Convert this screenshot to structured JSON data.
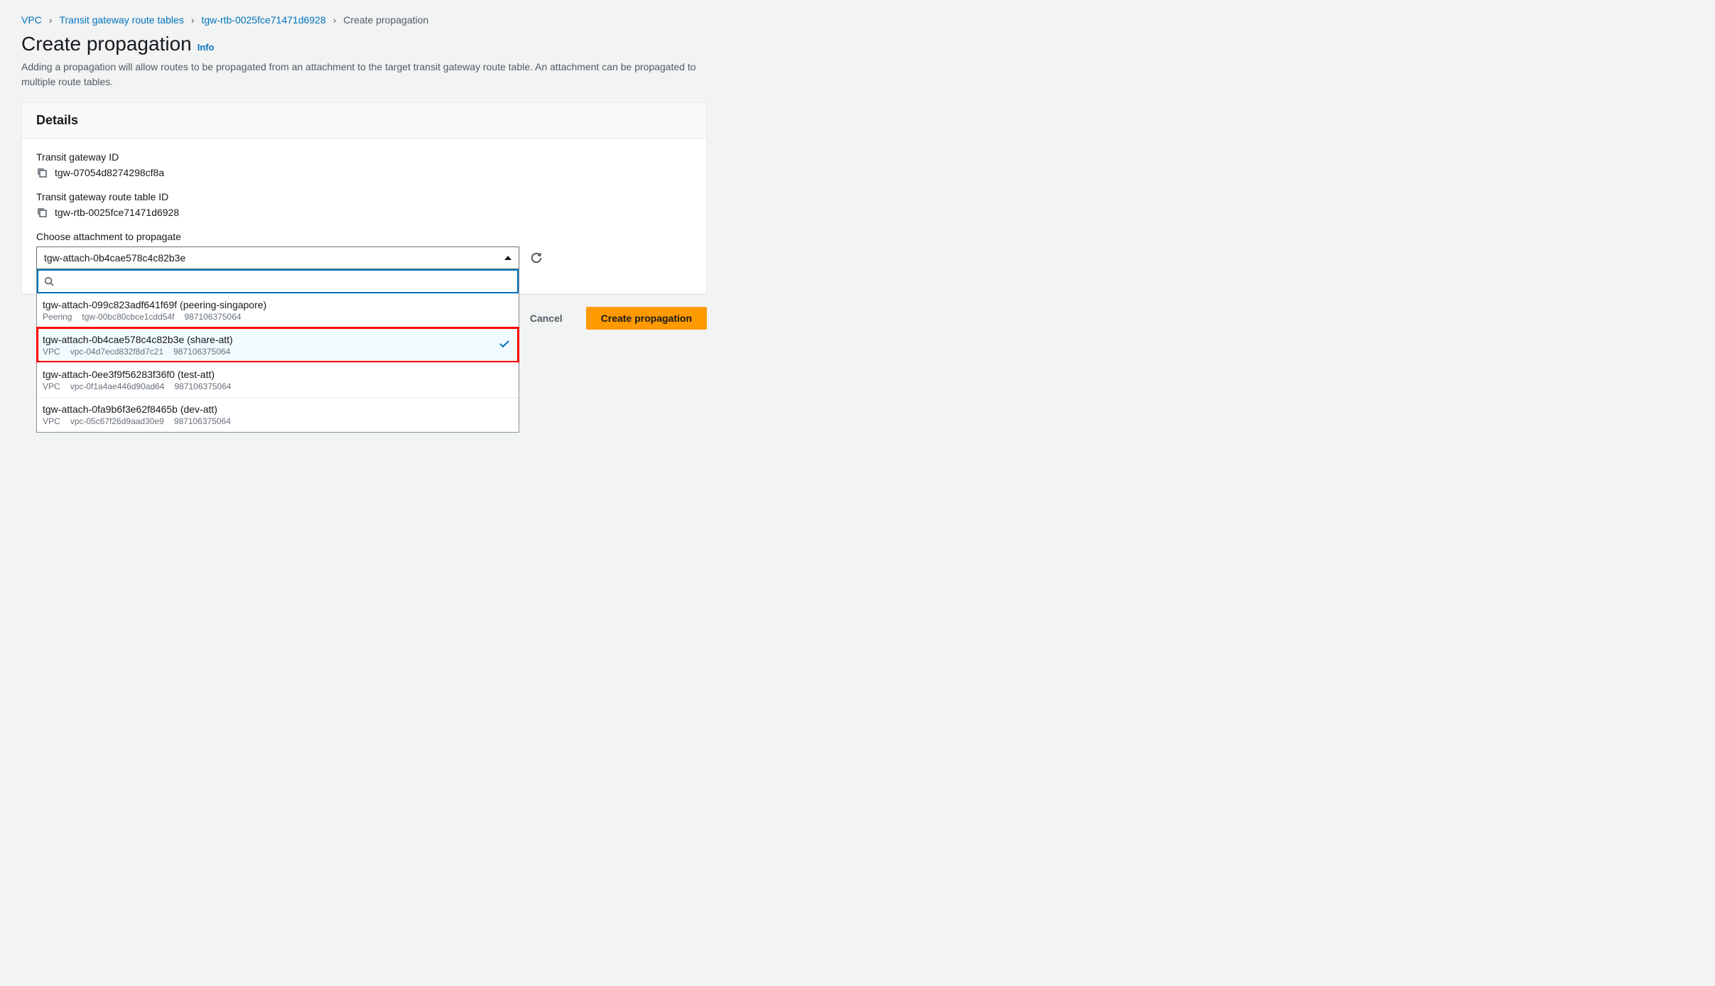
{
  "breadcrumb": {
    "items": [
      {
        "label": "VPC"
      },
      {
        "label": "Transit gateway route tables"
      },
      {
        "label": "tgw-rtb-0025fce71471d6928"
      }
    ],
    "current": "Create propagation"
  },
  "page": {
    "title": "Create propagation",
    "info": "Info",
    "description": "Adding a propagation will allow routes to be propagated from an attachment to the target transit gateway route table. An attachment can be propagated to multiple route tables."
  },
  "details": {
    "heading": "Details",
    "tgw_id_label": "Transit gateway ID",
    "tgw_id_value": "tgw-07054d8274298cf8a",
    "rtb_id_label": "Transit gateway route table ID",
    "rtb_id_value": "tgw-rtb-0025fce71471d6928",
    "choose_label": "Choose attachment to propagate",
    "selected_value": "tgw-attach-0b4cae578c4c82b3e"
  },
  "dropdown": {
    "search_value": "",
    "options": [
      {
        "title": "tgw-attach-099c823adf641f69f (peering-singapore)",
        "type": "Peering",
        "resource": "tgw-00bc80cbce1cdd54f",
        "account": "987106375064",
        "selected": false,
        "highlighted": false
      },
      {
        "title": "tgw-attach-0b4cae578c4c82b3e (share-att)",
        "type": "VPC",
        "resource": "vpc-04d7ecd832f8d7c21",
        "account": "987106375064",
        "selected": true,
        "highlighted": true
      },
      {
        "title": "tgw-attach-0ee3f9f56283f36f0 (test-att)",
        "type": "VPC",
        "resource": "vpc-0f1a4ae446d90ad64",
        "account": "987106375064",
        "selected": false,
        "highlighted": false
      },
      {
        "title": "tgw-attach-0fa9b6f3e62f8465b (dev-att)",
        "type": "VPC",
        "resource": "vpc-05c67f26d9aad30e9",
        "account": "987106375064",
        "selected": false,
        "highlighted": false
      }
    ]
  },
  "actions": {
    "cancel": "Cancel",
    "submit": "Create propagation"
  }
}
